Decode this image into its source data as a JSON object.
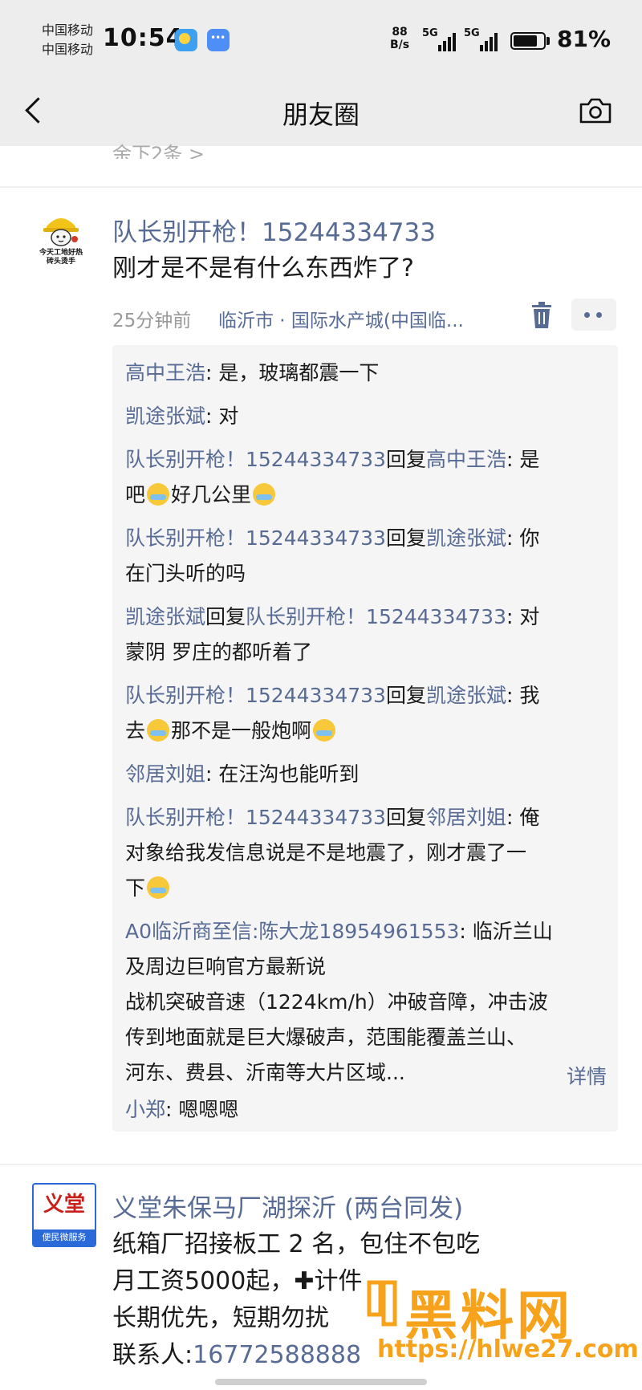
{
  "status_bar": {
    "carrier_1": "中国移动",
    "carrier_2": "中国移动",
    "time": "10:54",
    "net_speed_value": "88",
    "net_speed_unit": "B/s",
    "signal_1_label": "5G",
    "signal_2_label": "5G",
    "battery_text": "81%",
    "battery_level": 0.81
  },
  "nav": {
    "title": "朋友圈",
    "back_icon": "chevron-left-icon",
    "camera_icon": "camera-icon"
  },
  "cutoff_text": "余下2条 >",
  "post": {
    "author": "队长别开枪！15244334733",
    "avatar_caption_1": "今天工地好热",
    "avatar_caption_2": "砖头烫手",
    "text": "刚才是不是有什么东西炸了?",
    "time": "25分钟前",
    "location": "临沂市 · 国际水产城(中国临...",
    "delete_icon": "trash-icon",
    "more_icon": "more-dots-icon",
    "comments": {
      "c1_name": "高中王浩",
      "c1_text": ": 是，玻璃都震一下",
      "c2_name": "凯途张斌",
      "c2_text": ": 对",
      "c3_name": "队长别开枪！15244334733",
      "c3_reply": "回复",
      "c3_target": "高中王浩",
      "c3_text_1": ": 是",
      "c3_text_2": "吧",
      "c3_text_3": "好几公里",
      "c4_name": "队长别开枪！15244334733",
      "c4_reply": "回复",
      "c4_target": "凯途张斌",
      "c4_text_1": ": 你",
      "c4_text_2": "在门头听的吗",
      "c5_name": "凯途张斌",
      "c5_reply": "回复",
      "c5_target": "队长别开枪！15244334733",
      "c5_text_1": ": 对",
      "c5_text_2": "蒙阴  罗庄的都听着了",
      "c6_name": "队长别开枪！15244334733",
      "c6_reply": "回复",
      "c6_target": "凯途张斌",
      "c6_text_1": ": 我",
      "c6_text_2": "去",
      "c6_text_3": "那不是一般炮啊",
      "c7_name": "邻居刘姐",
      "c7_text": ": 在汪沟也能听到",
      "c8_name": "队长别开枪！15244334733",
      "c8_reply": "回复",
      "c8_target": "邻居刘姐",
      "c8_text_1": ": 俺",
      "c8_text_2": "对象给我发信息说是不是地震了，刚才震了一",
      "c8_text_3": "下",
      "c9_name": "A0临沂商至信:陈大龙18954961553",
      "c9_text_1": ": 临沂兰山",
      "c9_text_2": "及周边巨响官方最新说",
      "c9_text_3": "战机突破音速（1224km/h）冲破音障，冲击波",
      "c9_text_4": "传到地面就是巨大爆破声，范围能覆盖兰山、",
      "c9_text_5": "河东、费县、沂南等大片区域...",
      "c9_detail": "详情",
      "c10_name": "小郑",
      "c10_text": ": 嗯嗯嗯"
    }
  },
  "post2": {
    "author": "义堂朱保马厂湖探沂 (两台同发)",
    "logo_text": "义堂",
    "logo_subtext": "便民微服务",
    "line_1": "纸箱厂招接板工 2 名，包住不包吃",
    "line_2": "月工资5000起，✚计件",
    "line_3": "长期优先，短期勿扰",
    "line_4_label": "联系人:",
    "line_4_phone": "16772588888"
  },
  "watermark": {
    "text": "黑料网",
    "url": "https://hlwe27.com"
  },
  "colors": {
    "link_blue": "#576b95",
    "bar_gray": "#ededed",
    "watermark_orange": "#f7a21b"
  }
}
